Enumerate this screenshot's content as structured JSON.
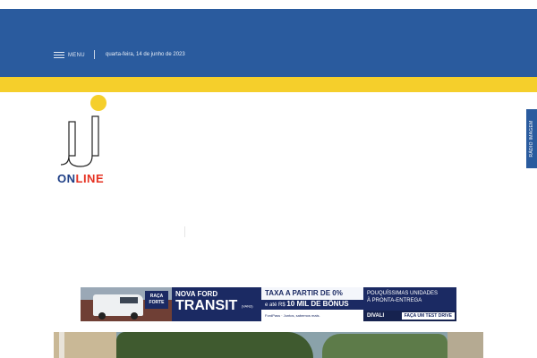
{
  "header": {
    "menu_label": "MENU",
    "date": "quarta-feira, 14 de junho de 2023",
    "bg_color": "#2a5b9e",
    "stripe_color": "#f5cf2b"
  },
  "logo": {
    "word_a": "ON",
    "word_b": "LINE",
    "dot_color": "#f5cf2b",
    "icon": "jj-logo-icon"
  },
  "side_tab": {
    "label": "RÁDIO IMAGEM"
  },
  "ad": {
    "tag": "RAÇA FORTE",
    "headline_small": "NOVA FORD",
    "headline_big": "TRANSIT",
    "headline_note": "(VAN3)",
    "offer_top": "TAXA A PARTIR DE 0%",
    "offer_mid_prefix": "e até R$",
    "offer_mid_value": "10 MIL DE BÔNUS",
    "offer_bottom": "FordPass · Juntos, sabemos mais.",
    "cta_top_1": "POUQUÍSSIMAS UNIDADES",
    "cta_top_2": "À PRONTA-ENTREGA",
    "dealer": "DIVALI",
    "cta_button": "FAÇA UM TEST DRIVE"
  },
  "photo": {
    "icon": "news-photo"
  }
}
